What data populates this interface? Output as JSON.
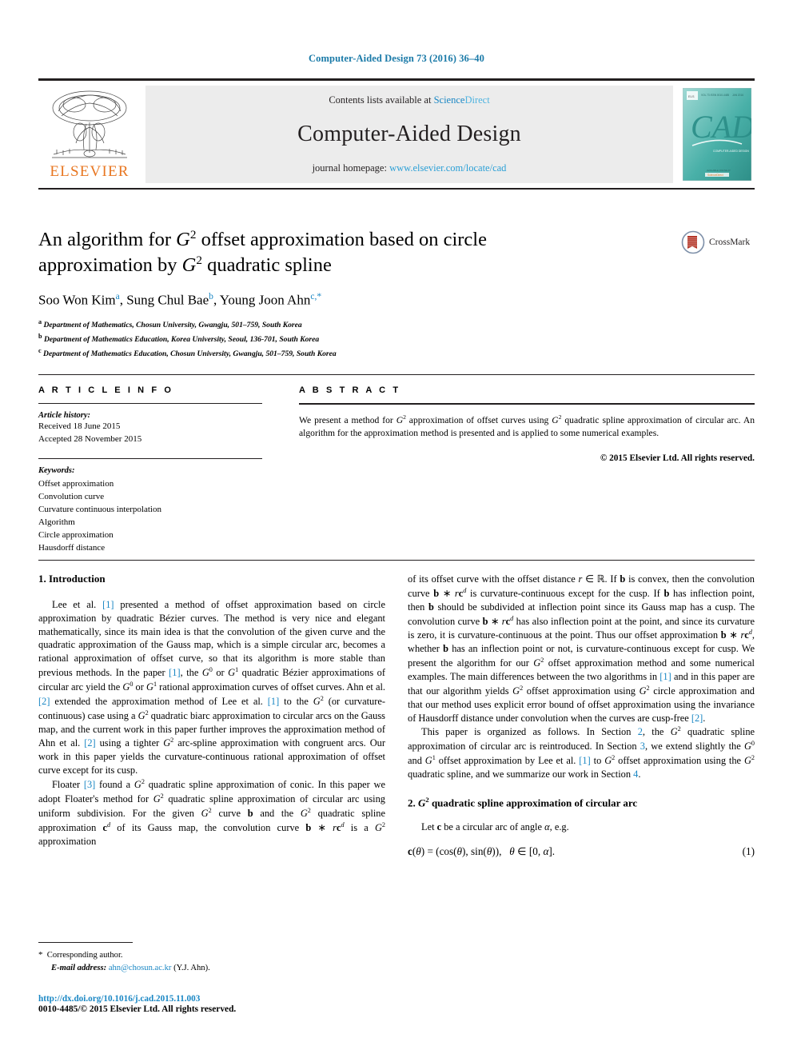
{
  "running_head": "Computer-Aided Design 73 (2016) 36–40",
  "banner": {
    "contents_prefix": "Contents lists available at ",
    "contents_link": "ScienceDirect",
    "journal_name": "Computer-Aided Design",
    "homepage_prefix": "journal homepage: ",
    "homepage_url": "www.elsevier.com/locate/cad",
    "publisher": "ELSEVIER",
    "cover_title": "CAD",
    "cover_subtitle": "COMPUTER-AIDED DESIGN",
    "link_color": "#2a9fd6",
    "publisher_color": "#e87722",
    "cover_color": "#3aa9a0"
  },
  "article": {
    "title_line1_a": "An algorithm for ",
    "title_g1": "G",
    "title_g1_sup": "2",
    "title_line1_b": " offset approximation based on circle",
    "title_line2_a": "approximation by ",
    "title_g2": "G",
    "title_g2_sup": "2",
    "title_line2_b": " quadratic spline",
    "authors": "Soo Won Kim",
    "author_a_sup": "a",
    "authors_2": ", Sung Chul Bae",
    "author_b_sup": "b",
    "authors_3": ", Young Joon Ahn",
    "author_c_sup": "c,*",
    "affiliations": [
      {
        "marker": "a",
        "text": "Department of Mathematics, Chosun University, Gwangju, 501–759, South Korea"
      },
      {
        "marker": "b",
        "text": "Department of Mathematics Education, Korea University, Seoul, 136-701, South Korea"
      },
      {
        "marker": "c",
        "text": "Department of Mathematics Education, Chosun University, Gwangju, 501–759, South Korea"
      }
    ],
    "crossmark_label": "CrossMark"
  },
  "article_info": {
    "heading": "A R T I C L E   I N F O",
    "history_heading": "Article history:",
    "received": "Received 18 June 2015",
    "accepted": "Accepted 28 November 2015",
    "keywords_heading": "Keywords:",
    "keywords": [
      "Offset approximation",
      "Convolution curve",
      "Curvature continuous interpolation",
      "Algorithm",
      "Circle approximation",
      "Hausdorff distance"
    ]
  },
  "abstract": {
    "heading": "A B S T R A C T",
    "text_1": "We present a method for ",
    "g_a": "G",
    "g_a_sup": "2",
    "text_2": " approximation of offset curves using ",
    "g_b": "G",
    "g_b_sup": "2",
    "text_3": " quadratic spline approximation of circular arc. An algorithm for the approximation method is presented and is applied to some numerical examples.",
    "copyright": "© 2015 Elsevier Ltd. All rights reserved."
  },
  "sections": {
    "intro_heading": "1. Introduction",
    "sec2_heading_num": "2. ",
    "sec2_heading_g": "G",
    "sec2_heading_sup": "2",
    "sec2_heading_rest": " quadratic spline approximation of circular arc",
    "sec2_lead": "Let c be a circular arc of angle α, e.g.",
    "equation_1": "c(θ) = (cos(θ), sin(θ)),    θ ∈ [0, α].",
    "equation_1_number": "(1)"
  },
  "body": {
    "left_p1": "Lee et al. [1] presented a method of offset approximation based on circle approximation by quadratic Bézier curves. The method is very nice and elegant mathematically, since its main idea is that the convolution of the given curve and the quadratic approximation of the Gauss map, which is a simple circular arc, becomes a rational approximation of offset curve, so that its algorithm is more stable than previous methods. In the paper [1], the G⁰ or G¹ quadratic Bézier approximations of circular arc yield the G⁰ or G¹ rational approximation curves of offset curves. Ahn et al. [2] extended the approximation method of Lee et al. [1] to the G² (or curvature-continuous) case using a G² quadratic biarc approximation to circular arcs on the Gauss map, and the current work in this paper further improves the approximation method of Ahn et al. [2] using a tighter G² arc-spline approximation with congruent arcs. Our work in this paper yields the curvature-continuous rational approximation of offset curve except for its cusp.",
    "left_p2": "Floater [3] found a G² quadratic spline approximation of conic. In this paper we adopt Floater's method for G² quadratic spline approximation of circular arc using uniform subdivision. For the given G² curve b and the G² quadratic spline approximation c^d of its Gauss map, the convolution curve b ∗ rc^d is a G² approximation",
    "right_p1": "of its offset curve with the offset distance r ∈ ℝ. If b is convex, then the convolution curve b ∗ rc^d is curvature-continuous except for the cusp. If b has inflection point, then b should be subdivided at inflection point since its Gauss map has a cusp. The convolution curve b ∗ rc^d has also inflection point at the point, and since its curvature is zero, it is curvature-continuous at the point. Thus our offset approximation b ∗ rc^d, whether b has an inflection point or not, is curvature-continuous except for cusp. We present the algorithm for our G² offset approximation method and some numerical examples. The main differences between the two algorithms in [1] and in this paper are that our algorithm yields G² offset approximation using G² circle approximation and that our method uses explicit error bound of offset approximation using the invariance of Hausdorff distance under convolution when the curves are cusp-free [2].",
    "right_p2": "This paper is organized as follows. In Section 2, the G² quadratic spline approximation of circular arc is reintroduced. In Section 3, we extend slightly the G⁰ and G¹ offset approximation by Lee et al. [1] to G² offset approximation using the G² quadratic spline, and we summarize our work in Section 4."
  },
  "footnote": {
    "star": "*",
    "corresponding": "Corresponding author.",
    "email_label": "E-mail address:",
    "email": "ahn@chosun.ac.kr",
    "email_suffix": "(Y.J. Ahn).",
    "doi": "http://dx.doi.org/10.1016/j.cad.2015.11.003",
    "issn": "0010-4485/© 2015 Elsevier Ltd. All rights reserved."
  }
}
